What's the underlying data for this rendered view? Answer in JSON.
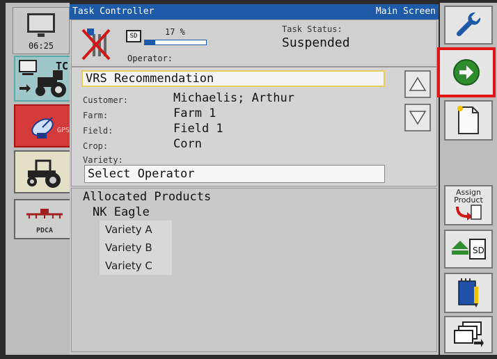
{
  "clock": {
    "time": "06:25"
  },
  "left_nav": {
    "tc_label": "TC",
    "gps_label": "GPS",
    "pdca_label": "PDCA"
  },
  "title_bar": {
    "app_title": "Task Controller",
    "screen_name": "Main Screen"
  },
  "status": {
    "sd_label": "SD",
    "progress_text": "17 %",
    "progress_value": 17,
    "operator_label": "Operator:",
    "task_status_label": "Task Status:",
    "task_status_value": "Suspended"
  },
  "recommendation": {
    "title": "VRS Recommendation",
    "fields": [
      {
        "label": "Customer:",
        "value": "Michaelis; Arthur"
      },
      {
        "label": "Farm:",
        "value": "Farm 1"
      },
      {
        "label": "Field:",
        "value": "Field 1"
      },
      {
        "label": "Crop:",
        "value": "Corn"
      },
      {
        "label": "Variety:",
        "value": ""
      }
    ],
    "select_operator": "Select Operator"
  },
  "allocated": {
    "title": "Allocated Products",
    "product": "NK Eagle",
    "varieties": [
      "Variety A",
      "Variety B",
      "Variety C"
    ]
  },
  "right_nav": {
    "assign_product_line1": "Assign",
    "assign_product_line2": "Product",
    "sd_label": "SD"
  },
  "colors": {
    "title_bar": "#1e5aa8",
    "highlight": "#e41414",
    "next_green": "#2e8b2e"
  }
}
